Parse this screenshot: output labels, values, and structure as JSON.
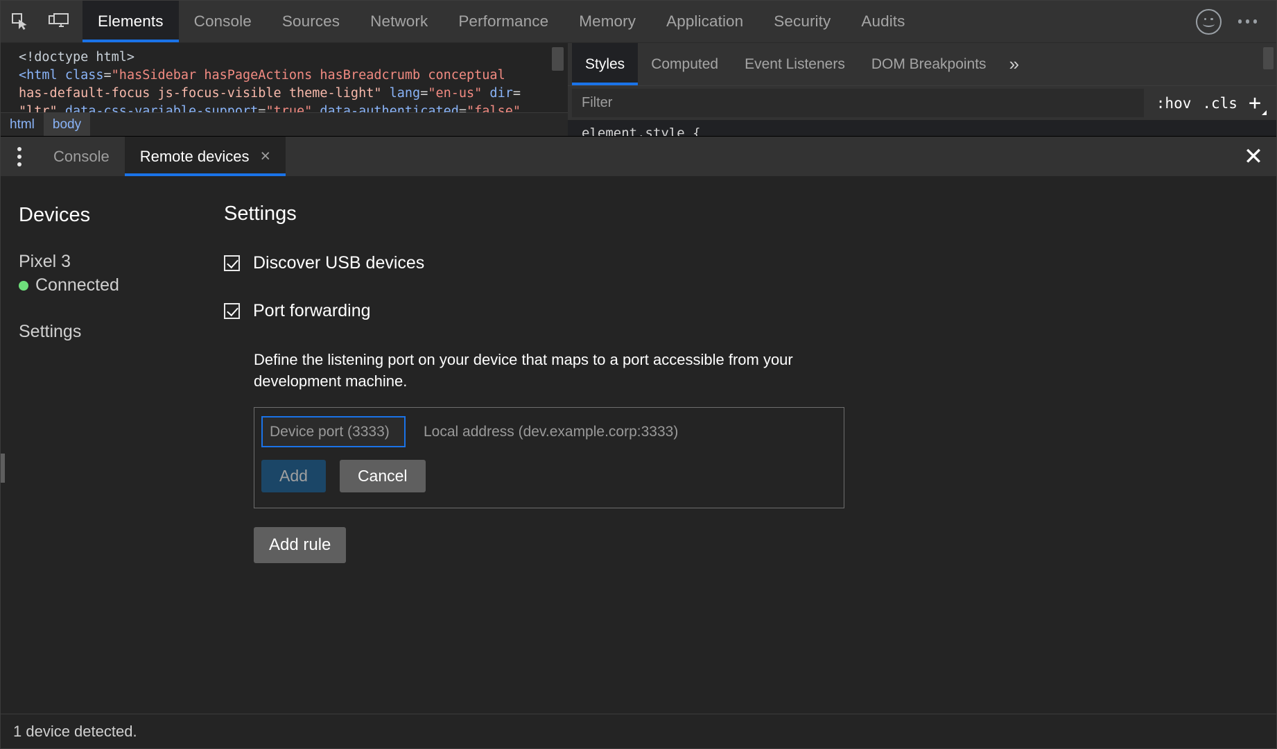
{
  "main_toolbar": {
    "inspect_icon": "inspect-element-icon",
    "device_toggle_icon": "device-toolbar-icon",
    "tabs": [
      {
        "label": "Elements",
        "active": true
      },
      {
        "label": "Console",
        "active": false
      },
      {
        "label": "Sources",
        "active": false
      },
      {
        "label": "Network",
        "active": false
      },
      {
        "label": "Performance",
        "active": false
      },
      {
        "label": "Memory",
        "active": false
      },
      {
        "label": "Application",
        "active": false
      },
      {
        "label": "Security",
        "active": false
      },
      {
        "label": "Audits",
        "active": false
      }
    ],
    "feedback_icon": "smiley-face-icon",
    "more_icon": "more-options-icon"
  },
  "elements_pane": {
    "dom_lines": [
      {
        "segments": [
          {
            "text": "<!doctype html>",
            "type": "doctype"
          }
        ]
      },
      {
        "segments": [
          {
            "text": "<html",
            "type": "tag"
          },
          {
            "text": " class",
            "type": "attr"
          },
          {
            "text": "=",
            "type": "eq"
          },
          {
            "text": "\"hasSidebar hasPageActions hasBreadcrumb conceptual",
            "type": "val"
          }
        ]
      },
      {
        "segments": [
          {
            "text": "has-default-focus js-focus-visible theme-light\"",
            "type": "plain"
          },
          {
            "text": " lang",
            "type": "attr"
          },
          {
            "text": "=",
            "type": "eq"
          },
          {
            "text": "\"en-us\"",
            "type": "val"
          },
          {
            "text": " dir",
            "type": "attr"
          },
          {
            "text": "=",
            "type": "eq"
          }
        ]
      },
      {
        "segments": [
          {
            "text": "\"ltr\"",
            "type": "plain"
          },
          {
            "text": " data-css-variable-support",
            "type": "attr"
          },
          {
            "text": "=",
            "type": "eq"
          },
          {
            "text": "\"true\"",
            "type": "val"
          },
          {
            "text": " data-authenticated",
            "type": "attr"
          },
          {
            "text": "=",
            "type": "eq"
          },
          {
            "text": "\"false\"",
            "type": "val"
          }
        ]
      }
    ],
    "breadcrumb": [
      {
        "label": "html",
        "selected": false
      },
      {
        "label": "body",
        "selected": true
      }
    ]
  },
  "styles_pane": {
    "tabs": [
      {
        "label": "Styles",
        "active": true
      },
      {
        "label": "Computed",
        "active": false
      },
      {
        "label": "Event Listeners",
        "active": false
      },
      {
        "label": "DOM Breakpoints",
        "active": false
      }
    ],
    "overflow_label": "»",
    "filter_placeholder": "Filter",
    "filter_value": "",
    "hov_label": ":hov",
    "cls_label": ".cls",
    "plus_label": "+",
    "element_style_text": "element.style {"
  },
  "drawer": {
    "menu_icon": "drawer-menu-icon",
    "tabs": [
      {
        "label": "Console",
        "active": false,
        "closable": false
      },
      {
        "label": "Remote devices",
        "active": true,
        "closable": true
      }
    ],
    "close_tab_label": "×",
    "close_drawer_label": "✕"
  },
  "remote_devices": {
    "sidebar": {
      "title": "Devices",
      "device_name": "Pixel 3",
      "device_status": "Connected",
      "status_color": "#6ee07b",
      "settings_label": "Settings"
    },
    "settings": {
      "title": "Settings",
      "discover_usb": {
        "label": "Discover USB devices",
        "checked": true
      },
      "port_forwarding": {
        "label": "Port forwarding",
        "checked": true
      },
      "description": "Define the listening port on your device that maps to a port accessible from your development machine.",
      "rule": {
        "device_port_placeholder": "Device port (3333)",
        "device_port_value": "",
        "local_address_placeholder": "Local address (dev.example.corp:3333)",
        "local_address_value": "",
        "add_label": "Add",
        "cancel_label": "Cancel"
      },
      "add_rule_label": "Add rule"
    }
  },
  "status_bar": {
    "text": "1 device detected."
  }
}
